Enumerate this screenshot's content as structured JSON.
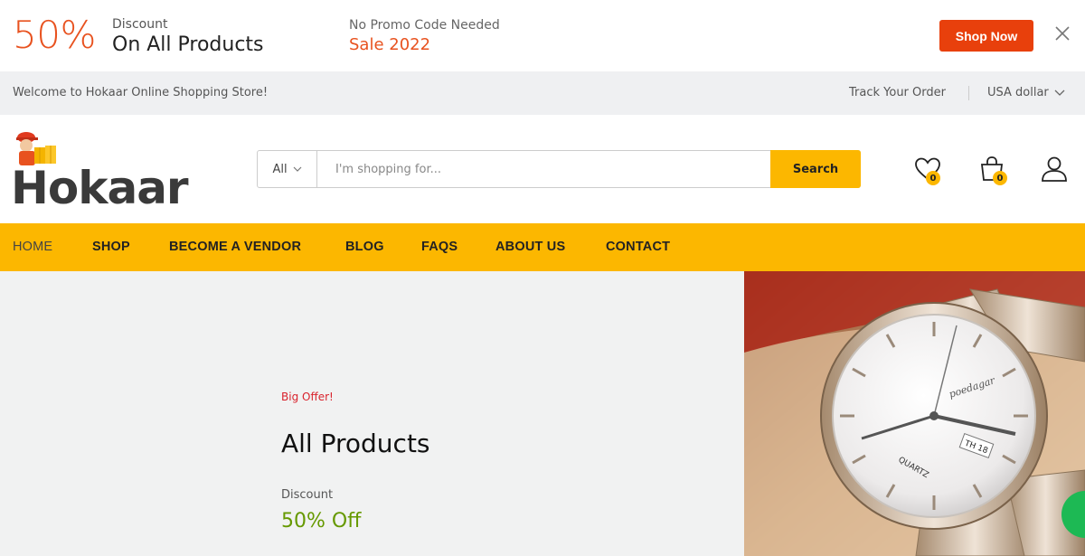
{
  "promo": {
    "percent": "50%",
    "discount_label": "Discount",
    "discount_text": "On All Products",
    "no_code": "No Promo Code Needed",
    "sale": "Sale 2022",
    "shop_button": "Shop Now"
  },
  "topbar": {
    "welcome": "Welcome to Hokaar Online Shopping Store!",
    "track": "Track Your Order",
    "currency": "USA dollar"
  },
  "header": {
    "logo_text": "Hokaar",
    "search_category": "All",
    "search_placeholder": "I'm shopping for...",
    "search_button": "Search",
    "wishlist_count": "0",
    "cart_count": "0"
  },
  "nav": {
    "items": [
      "HOME",
      "SHOP",
      "BECOME A VENDOR",
      "BLOG",
      "FAQS",
      "ABOUT US",
      "CONTACT"
    ]
  },
  "hero": {
    "tag": "Big Offer!",
    "title": "All Products",
    "discount_label": "Discount",
    "discount_value": "50% Off",
    "watch_brand": "poedagar",
    "watch_label": "QUARTZ",
    "watch_date": "TH 18"
  },
  "colors": {
    "accent_orange": "#e8521f",
    "accent_yellow": "#fcb700",
    "offer_red": "#d9232d",
    "offer_green": "#669900"
  }
}
